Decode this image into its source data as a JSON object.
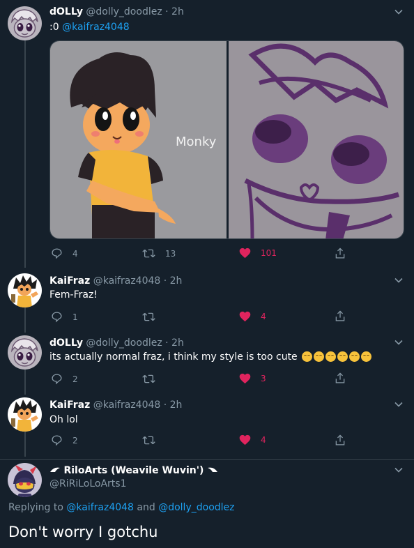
{
  "tweets": [
    {
      "name": "dOLLy",
      "handle": "@dolly_doodlez",
      "time": "· 2h",
      "text_prefix": ":0",
      "mention": "@kaifraz4048",
      "has_media": true,
      "media_watermark": "Monky",
      "replies": "4",
      "retweets": "13",
      "likes": "101"
    },
    {
      "name": "KaiFraz",
      "handle": "@kaifraz4048",
      "time": "· 2h",
      "text": "Fem-Fraz!",
      "replies": "1",
      "retweets": "",
      "likes": "4"
    },
    {
      "name": "dOLLy",
      "handle": "@dolly_doodlez",
      "time": "· 2h",
      "text": "its actually normal fraz, i think my style is too cute",
      "emoji_count": 6,
      "replies": "2",
      "retweets": "",
      "likes": "3"
    },
    {
      "name": "KaiFraz",
      "handle": "@kaifraz4048",
      "time": "· 2h",
      "text": "Oh lol",
      "replies": "2",
      "retweets": "",
      "likes": "4"
    }
  ],
  "main_tweet": {
    "name": "RiloArts (Weavile Wuvin')",
    "handle": "@RiRiLoLoArts1",
    "replying_prefix": "Replying to",
    "replying_to_1": "@kaifraz4048",
    "replying_and": "and",
    "replying_to_2": "@dolly_doodlez",
    "text": "Don't worry I gotchu"
  },
  "colors": {
    "background": "#15202b",
    "secondary_text": "#8899a6",
    "link": "#1da1f2",
    "like": "#e0245e",
    "border": "#38444d"
  }
}
